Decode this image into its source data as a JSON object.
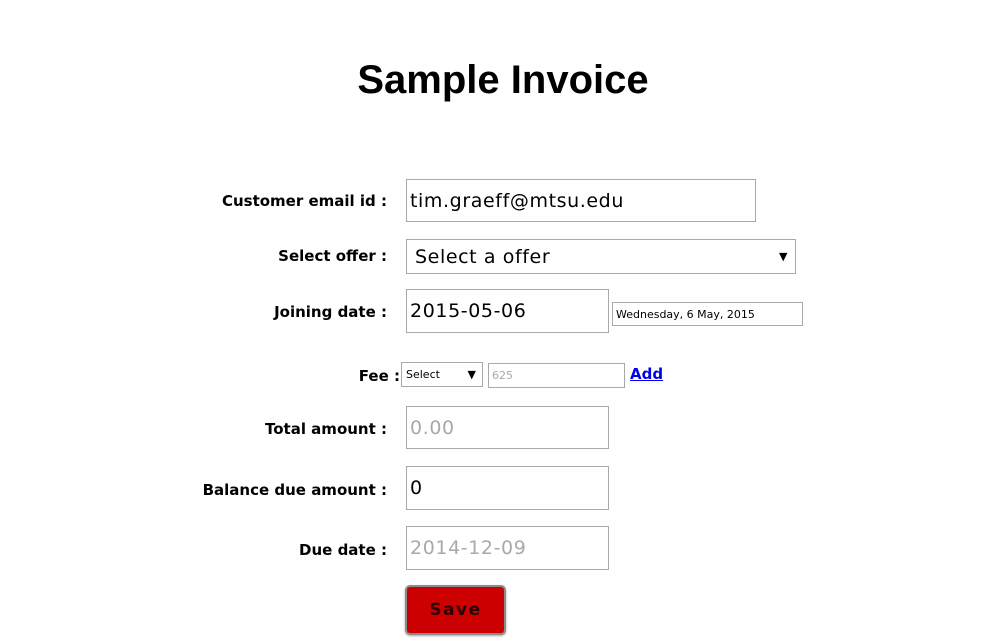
{
  "page": {
    "title": "Sample Invoice"
  },
  "form": {
    "customer_email": {
      "label": "Customer email id :",
      "value": "tim.graeff@mtsu.edu"
    },
    "offer": {
      "label": "Select offer :",
      "selected": "Select a offer"
    },
    "joining_date": {
      "label": "Joining date :",
      "value": "2015-05-06",
      "display": "Wednesday, 6 May, 2015"
    },
    "fee": {
      "label": "Fee :",
      "select_value": "Select",
      "placeholder": "625",
      "add_label": "Add"
    },
    "total_amount": {
      "label": "Total amount :",
      "placeholder": "0.00"
    },
    "balance_due": {
      "label": "Balance due amount :",
      "value": "0"
    },
    "due_date": {
      "label": "Due date :",
      "placeholder": "2014-12-09"
    },
    "save_label": "Save"
  },
  "icons": {
    "dropdown": "chevron-down-icon"
  }
}
